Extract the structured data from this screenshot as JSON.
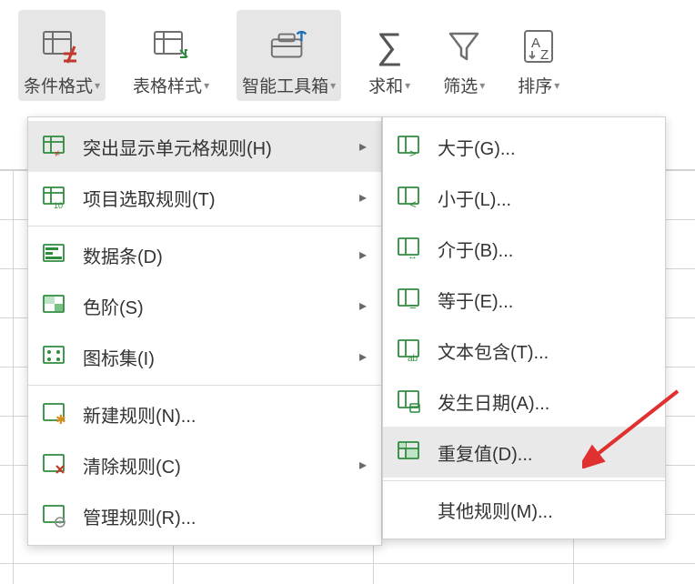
{
  "toolbar": {
    "conditional_format": "条件格式",
    "table_style": "表格样式",
    "smart_toolbox": "智能工具箱",
    "sum": "求和",
    "filter": "筛选",
    "sort": "排序"
  },
  "menu": {
    "highlight_rules": "突出显示单元格规则(H)",
    "top_bottom": "项目选取规则(T)",
    "data_bars": "数据条(D)",
    "color_scales": "色阶(S)",
    "icon_sets": "图标集(I)",
    "new_rule": "新建规则(N)...",
    "clear_rules": "清除规则(C)",
    "manage_rules": "管理规则(R)..."
  },
  "submenu": {
    "greater": "大于(G)...",
    "less": "小于(L)...",
    "between": "介于(B)...",
    "equal": "等于(E)...",
    "text_contains": "文本包含(T)...",
    "date": "发生日期(A)...",
    "duplicate": "重复值(D)...",
    "more_rules": "其他规则(M)..."
  }
}
